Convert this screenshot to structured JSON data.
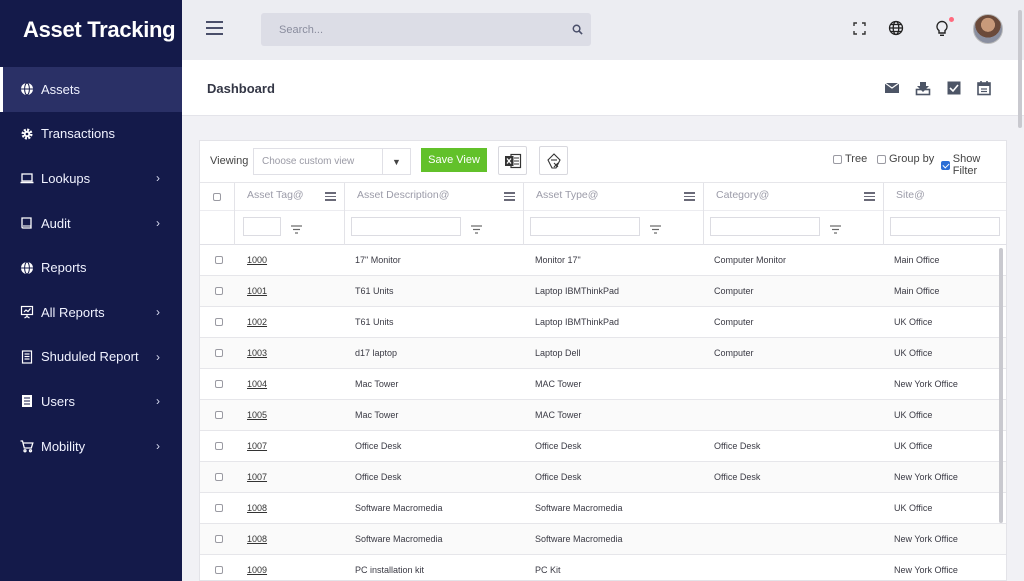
{
  "app": {
    "title": "Asset Tracking"
  },
  "sidebar": {
    "items": [
      {
        "label": "Assets",
        "icon": "globe-icon",
        "active": true,
        "has_children": false
      },
      {
        "label": "Transactions",
        "icon": "gear-icon",
        "active": false,
        "has_children": false
      },
      {
        "label": "Lookups",
        "icon": "laptop-icon",
        "active": false,
        "has_children": true
      },
      {
        "label": "Audit",
        "icon": "book-icon",
        "active": false,
        "has_children": true
      },
      {
        "label": "Reports",
        "icon": "globe-icon",
        "active": false,
        "has_children": false
      },
      {
        "label": "All Reports",
        "icon": "presentation-icon",
        "active": false,
        "has_children": true
      },
      {
        "label": "Shuduled Report",
        "icon": "document-icon",
        "active": false,
        "has_children": true
      },
      {
        "label": "Users",
        "icon": "list-icon",
        "active": false,
        "has_children": true
      },
      {
        "label": "Mobility",
        "icon": "cart-icon",
        "active": false,
        "has_children": true
      }
    ],
    "chevron": "›"
  },
  "topbar": {
    "search_placeholder": "Search...",
    "icons": [
      "fullscreen-icon",
      "language-globe-icon",
      "lightbulb-icon",
      "user-avatar"
    ]
  },
  "dashboard": {
    "title": "Dashboard",
    "icons": [
      "mail-icon",
      "download-icon",
      "checkbox-icon",
      "calendar-icon"
    ]
  },
  "toolbar": {
    "viewing_label": "Viewing",
    "view_placeholder": "Choose custom view",
    "save_view_label": "Save  View",
    "tree_label": "Tree",
    "group_by_label": "Group by",
    "show_filter_label": "Show Filter",
    "tree_checked": false,
    "group_by_checked": false,
    "show_filter_checked": true
  },
  "grid": {
    "columns": [
      "Asset Tag@",
      "Asset Description@",
      "Asset Type@",
      "Category@",
      "Site@"
    ],
    "rows": [
      [
        "1000",
        "17\" Monitor",
        "Monitor 17\"",
        "Computer Monitor",
        "Main Office"
      ],
      [
        "1001",
        "T61 Units",
        "Laptop IBMThinkPad",
        "Computer",
        "Main Office"
      ],
      [
        "1002",
        "T61 Units",
        "Laptop IBMThinkPad",
        "Computer",
        "UK Office"
      ],
      [
        "1003",
        "d17 laptop",
        "Laptop Dell",
        "Computer",
        "UK Office"
      ],
      [
        "1004",
        "Mac Tower",
        "MAC Tower",
        "",
        "New York Office"
      ],
      [
        "1005",
        "Mac Tower",
        "MAC Tower",
        "",
        "UK Office"
      ],
      [
        "1007",
        "Office Desk",
        "Office Desk",
        "Office Desk",
        "UK Office"
      ],
      [
        "1007",
        "Office Desk",
        "Office Desk",
        "Office Desk",
        "New York Office"
      ],
      [
        "1008",
        "Software Macromedia",
        "Software Macromedia",
        "",
        "UK Office"
      ],
      [
        "1008",
        "Software Macromedia",
        "Software Macromedia",
        "",
        "New York Office"
      ],
      [
        "1009",
        "PC installation kit",
        "PC Kit",
        "",
        "New York Office"
      ]
    ]
  },
  "colors": {
    "sidebar_bg": "#141a4a",
    "save_button": "#62c12a",
    "notification_dot": "#ff6a7e"
  }
}
